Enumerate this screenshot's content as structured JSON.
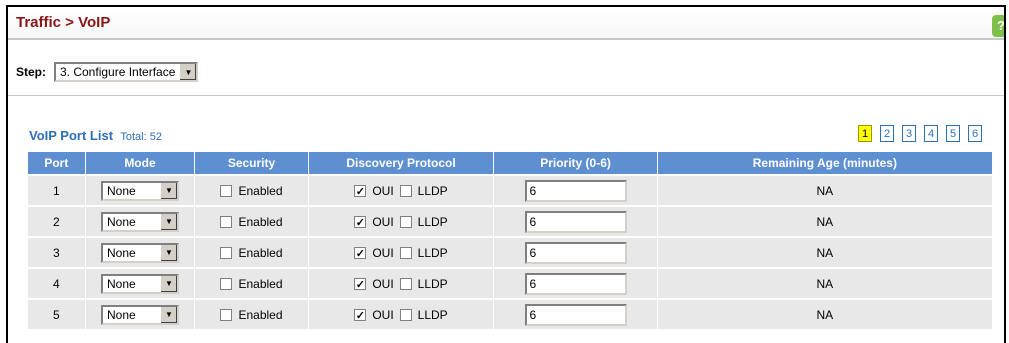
{
  "header": {
    "title": "Traffic > VoIP",
    "help_icon": "help-icon"
  },
  "step": {
    "label": "Step:",
    "selected": "3. Configure Interface"
  },
  "list": {
    "title": "VoIP Port List",
    "total_label": "Total: 52",
    "pages": [
      "1",
      "2",
      "3",
      "4",
      "5",
      "6"
    ],
    "active_page": "1"
  },
  "table": {
    "columns": [
      "Port",
      "Mode",
      "Security",
      "Discovery Protocol",
      "Priority (0-6)",
      "Remaining Age (minutes)"
    ],
    "rows": [
      {
        "port": "1",
        "mode": "None",
        "security_label": "Enabled",
        "security_checked": false,
        "oui_label": "OUI",
        "oui_checked": true,
        "lldp_label": "LLDP",
        "lldp_checked": false,
        "priority": "6",
        "remaining_age": "NA"
      },
      {
        "port": "2",
        "mode": "None",
        "security_label": "Enabled",
        "security_checked": false,
        "oui_label": "OUI",
        "oui_checked": true,
        "lldp_label": "LLDP",
        "lldp_checked": false,
        "priority": "6",
        "remaining_age": "NA"
      },
      {
        "port": "3",
        "mode": "None",
        "security_label": "Enabled",
        "security_checked": false,
        "oui_label": "OUI",
        "oui_checked": true,
        "lldp_label": "LLDP",
        "lldp_checked": false,
        "priority": "6",
        "remaining_age": "NA"
      },
      {
        "port": "4",
        "mode": "None",
        "security_label": "Enabled",
        "security_checked": false,
        "oui_label": "OUI",
        "oui_checked": true,
        "lldp_label": "LLDP",
        "lldp_checked": false,
        "priority": "6",
        "remaining_age": "NA"
      },
      {
        "port": "5",
        "mode": "None",
        "security_label": "Enabled",
        "security_checked": false,
        "oui_label": "OUI",
        "oui_checked": true,
        "lldp_label": "LLDP",
        "lldp_checked": false,
        "priority": "6",
        "remaining_age": "NA"
      }
    ]
  },
  "colors": {
    "title": "#8a1515",
    "accent": "#2e6eb8",
    "table_header": "#5d8fd1",
    "row_bg": "#e8e8e8",
    "active_page": "#ffff00"
  }
}
